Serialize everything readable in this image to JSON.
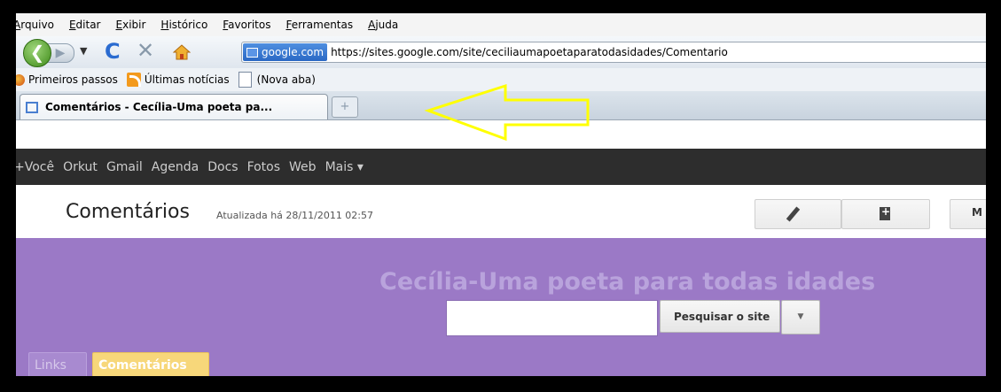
{
  "menu": [
    "Arquivo",
    "Editar",
    "Exibir",
    "Histórico",
    "Favoritos",
    "Ferramentas",
    "Ajuda"
  ],
  "nav": {
    "site_identity": "google.com",
    "url": "https://sites.google.com/site/ceciliaumapoetaparatodasidades/Comentario"
  },
  "bookmarks": [
    "Primeiros passos",
    "Últimas notícias",
    "(Nova aba)"
  ],
  "tab": {
    "title": "Comentários - Cecília-Uma poeta pa...",
    "new_tab": "+"
  },
  "google_bar": [
    "+Você",
    "Orkut",
    "Gmail",
    "Agenda",
    "Docs",
    "Fotos",
    "Web",
    "Mais ▾"
  ],
  "page": {
    "title": "Comentários",
    "updated": "Atualizada há 28/11/2011 02:57",
    "more_label": "M"
  },
  "site": {
    "name": "Cecília-Uma poeta para todas idades",
    "search_button": "Pesquisar o site",
    "nav_tabs": [
      "Links",
      "Comentários"
    ]
  },
  "colors": {
    "google_bar": "#2d2d2d",
    "site_header": "#9b79c6",
    "active_tab": "#f7d77a",
    "annotation_arrow": "#ffff00"
  }
}
